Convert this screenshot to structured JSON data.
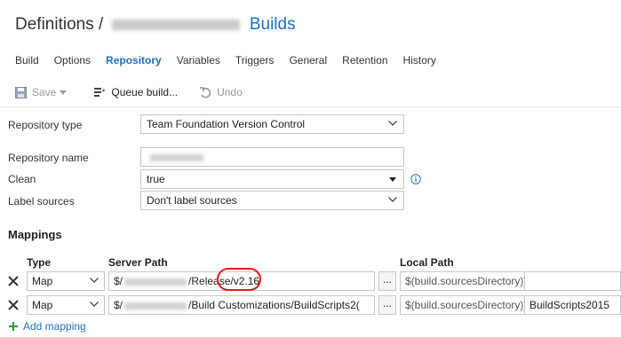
{
  "header": {
    "prefix": "Definitions /",
    "builds": "Builds"
  },
  "tabs": [
    {
      "label": "Build"
    },
    {
      "label": "Options"
    },
    {
      "label": "Repository",
      "active": true
    },
    {
      "label": "Variables"
    },
    {
      "label": "Triggers"
    },
    {
      "label": "General"
    },
    {
      "label": "Retention"
    },
    {
      "label": "History"
    }
  ],
  "toolbar": {
    "save": "Save",
    "queue": "Queue build...",
    "undo": "Undo"
  },
  "form": {
    "repo_type_label": "Repository type",
    "repo_type_value": "Team Foundation Version Control",
    "repo_name_label": "Repository name",
    "clean_label": "Clean",
    "clean_value": "true",
    "label_sources_label": "Label sources",
    "label_sources_value": "Don't label sources"
  },
  "mappings": {
    "title": "Mappings",
    "col_type": "Type",
    "col_server": "Server Path",
    "col_local": "Local Path",
    "rows": [
      {
        "type": "Map",
        "server_prefix": "$/",
        "server_suffix": "/Release/v2.16",
        "browse": "...",
        "local_prefix": "$(build.sourcesDirectory)\\",
        "local_value": ""
      },
      {
        "type": "Map",
        "server_prefix": "$/",
        "server_suffix": "/Build Customizations/BuildScripts2(",
        "browse": "...",
        "local_prefix": "$(build.sourcesDirectory)\\",
        "local_value": "BuildScripts2015"
      }
    ],
    "add": "Add mapping"
  },
  "colors": {
    "accent": "#1e6fc0",
    "highlight": "#e01b1b",
    "add_plus": "#2e9e3e"
  }
}
